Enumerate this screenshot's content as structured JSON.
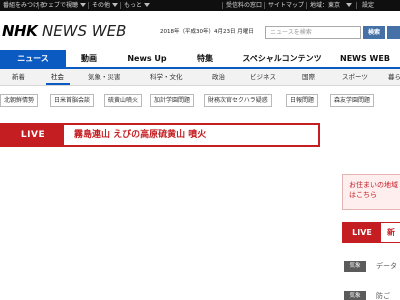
{
  "topbar": {
    "links": [
      "番組をみつける",
      "ウェブで視聴",
      "その他",
      "もっと"
    ],
    "right_links": [
      "受信料の窓口",
      "サイトマップ",
      "地域：東京",
      "設定"
    ]
  },
  "header": {
    "logo_nhk": "NHK",
    "logo_web": "NEWS WEB",
    "date": "2018年（平成30年）4月23日 月曜日",
    "search_placeholder": "ニュースを検索",
    "search_button": "検索"
  },
  "main_nav": [
    "ニュース",
    "動画",
    "News Up",
    "特集",
    "スペシャルコンテンツ",
    "NEWS WEB"
  ],
  "sub_nav": [
    "新着",
    "社会",
    "気象・災害",
    "科学・文化",
    "政治",
    "ビジネス",
    "国際",
    "スポーツ",
    "暮らし"
  ],
  "topics": [
    "北朝鮮情勢",
    "日米首脳会談",
    "硫黄山噴火",
    "加計学園問題",
    "財務次官セクハラ疑惑",
    "日報問題",
    "森友学園問題"
  ],
  "live": {
    "badge": "LIVE",
    "title": "霧島連山 えびの高原硫黄山 噴火"
  },
  "side": {
    "area_line1": "お住まいの地域",
    "area_line2": "はこちら",
    "live_badge": "LIVE",
    "live_title": "新",
    "news_rows": [
      {
        "badge": "気象",
        "text": "データ"
      },
      {
        "badge": "気象",
        "text": "防ご"
      }
    ]
  },
  "colors": {
    "topbar": "#0f0f0f",
    "nav_blue": "#0a5ac2",
    "search_blue": "#4571a7",
    "live_red": "#c41e22",
    "area_bg": "#ffeeee"
  }
}
